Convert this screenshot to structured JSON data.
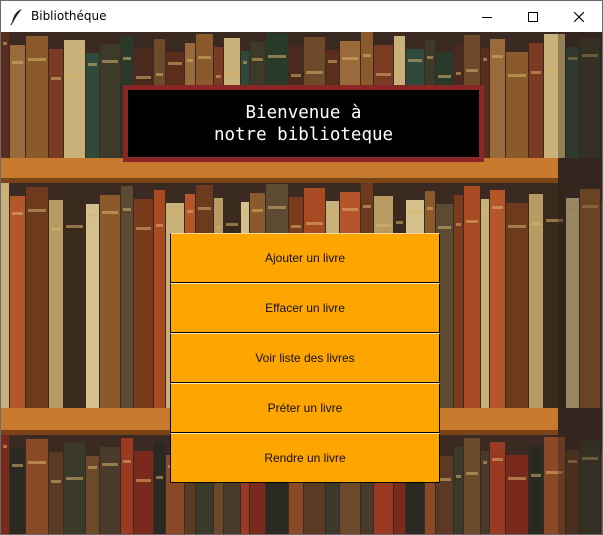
{
  "window": {
    "title": "Bibliothéque",
    "controls": [
      "minimize-icon",
      "maximize-icon",
      "close-icon"
    ]
  },
  "banner": {
    "line1": "Bienvenue à",
    "line2": "notre biblioteque"
  },
  "menu": {
    "items": [
      {
        "label": "Ajouter un livre"
      },
      {
        "label": "Effacer un livre"
      },
      {
        "label": "Voir liste des livres"
      },
      {
        "label": "Préter un livre"
      },
      {
        "label": "Rendre un livre"
      }
    ]
  },
  "colors": {
    "button": "#ffa500",
    "banner_bg": "#000000",
    "banner_border": "#8b2626",
    "banner_text": "#ffffff"
  }
}
